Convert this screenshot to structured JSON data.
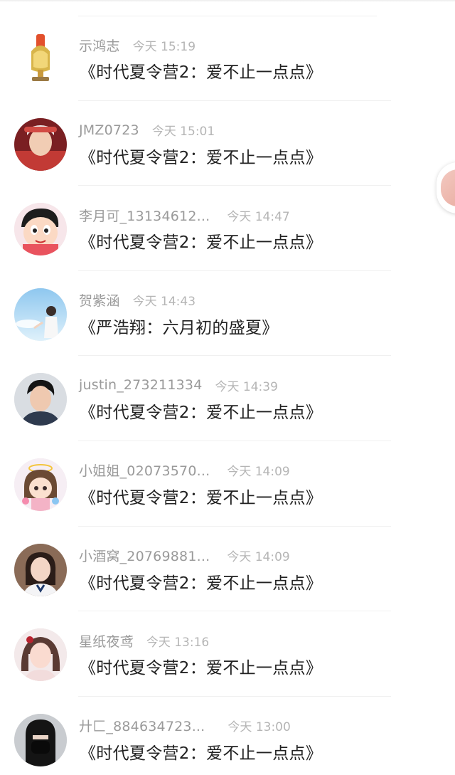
{
  "messages": [
    {
      "user": "示鸿志",
      "time": "今天 15:19",
      "title": "《时代夏令营2：爱不止一点点》",
      "avatar": "trophy-avatar"
    },
    {
      "user": "JMZ0723",
      "time": "今天 15:01",
      "title": "《时代夏令营2：爱不止一点点》",
      "avatar": "user-avatar"
    },
    {
      "user": "李月可_13134612...",
      "time": "今天 14:47",
      "title": "《时代夏令营2：爱不止一点点》",
      "avatar": "cartoon-avatar"
    },
    {
      "user": "贺紫涵",
      "time": "今天 14:43",
      "title": "《严浩翔：六月初的盛夏》",
      "avatar": "sky-avatar"
    },
    {
      "user": "justin_273211334",
      "time": "今天 14:39",
      "title": "《时代夏令营2：爱不止一点点》",
      "avatar": "user-avatar"
    },
    {
      "user": "小姐姐_02073570...",
      "time": "今天 14:09",
      "title": "《时代夏令营2：爱不止一点点》",
      "avatar": "anime-avatar"
    },
    {
      "user": "小酒窝_20769881...",
      "time": "今天 14:09",
      "title": "《时代夏令营2：爱不止一点点》",
      "avatar": "user-avatar"
    },
    {
      "user": "星纸夜鸢",
      "time": "今天 13:16",
      "title": "《时代夏令营2：爱不止一点点》",
      "avatar": "user-avatar"
    },
    {
      "user": "廾匚_884634723...",
      "time": "今天 13:00",
      "title": "《时代夏令营2：爱不止一点点》",
      "avatar": "masked-avatar"
    }
  ]
}
